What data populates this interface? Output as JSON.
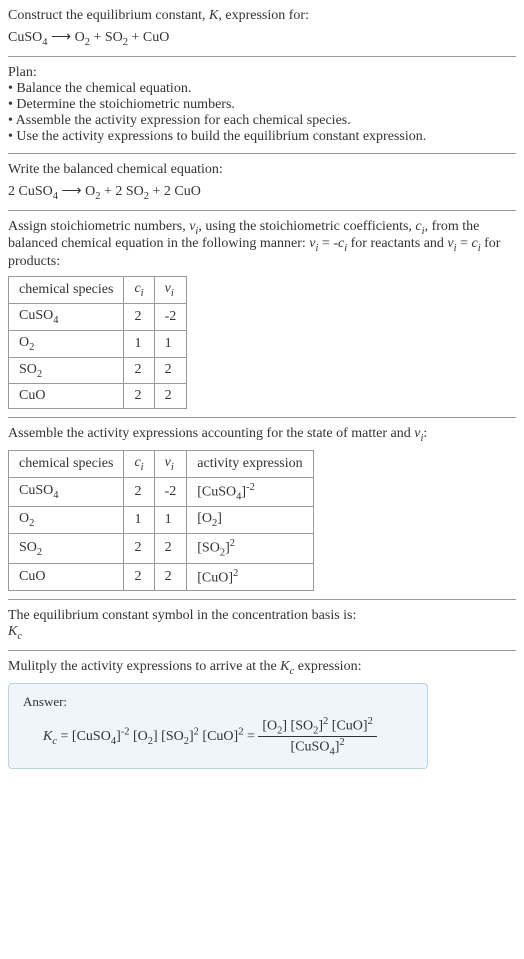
{
  "title": "Construct the equilibrium constant, K, expression for:",
  "reaction_unbalanced": "CuSO₄ ⟶ O₂ + SO₂ + CuO",
  "plan_label": "Plan:",
  "plan_items": [
    "Balance the chemical equation.",
    "Determine the stoichiometric numbers.",
    "Assemble the activity expression for each chemical species.",
    "Use the activity expressions to build the equilibrium constant expression."
  ],
  "balanced_label": "Write the balanced chemical equation:",
  "reaction_balanced": "2 CuSO₄ ⟶ O₂ + 2 SO₂ + 2 CuO",
  "stoich_text_1": "Assign stoichiometric numbers, ",
  "stoich_nu": "ν",
  "stoich_i": "i",
  "stoich_text_2": ", using the stoichiometric coefficients, ",
  "stoich_c": "c",
  "stoich_text_3": ", from the balanced chemical equation in the following manner: ",
  "stoich_eq1": "νᵢ = -cᵢ",
  "stoich_text_4": " for reactants and ",
  "stoich_eq2": "νᵢ = cᵢ",
  "stoich_text_5": " for products:",
  "table1_headers": {
    "species": "chemical species",
    "ci": "cᵢ",
    "nui": "νᵢ"
  },
  "table1_rows": [
    {
      "species": "CuSO₄",
      "ci": "2",
      "nui": "-2"
    },
    {
      "species": "O₂",
      "ci": "1",
      "nui": "1"
    },
    {
      "species": "SO₂",
      "ci": "2",
      "nui": "2"
    },
    {
      "species": "CuO",
      "ci": "2",
      "nui": "2"
    }
  ],
  "activity_label_1": "Assemble the activity expressions accounting for the state of matter and ",
  "activity_label_2": ":",
  "table2_headers": {
    "species": "chemical species",
    "ci": "cᵢ",
    "nui": "νᵢ",
    "activity": "activity expression"
  },
  "table2_rows": [
    {
      "species": "CuSO₄",
      "ci": "2",
      "nui": "-2",
      "activity": "[CuSO₄]⁻²"
    },
    {
      "species": "O₂",
      "ci": "1",
      "nui": "1",
      "activity": "[O₂]"
    },
    {
      "species": "SO₂",
      "ci": "2",
      "nui": "2",
      "activity": "[SO₂]²"
    },
    {
      "species": "CuO",
      "ci": "2",
      "nui": "2",
      "activity": "[CuO]²"
    }
  ],
  "eq_const_label": "The equilibrium constant symbol in the concentration basis is:",
  "kc_symbol": "K",
  "kc_sub": "c",
  "multiply_label_1": "Mulitply the activity expressions to arrive at the ",
  "multiply_label_2": " expression:",
  "answer_label": "Answer:",
  "kc_eq_left": "Kc = [CuSO₄]⁻² [O₂] [SO₂]² [CuO]² = ",
  "kc_num": "[O₂] [SO₂]² [CuO]²",
  "kc_den": "[CuSO₄]²"
}
